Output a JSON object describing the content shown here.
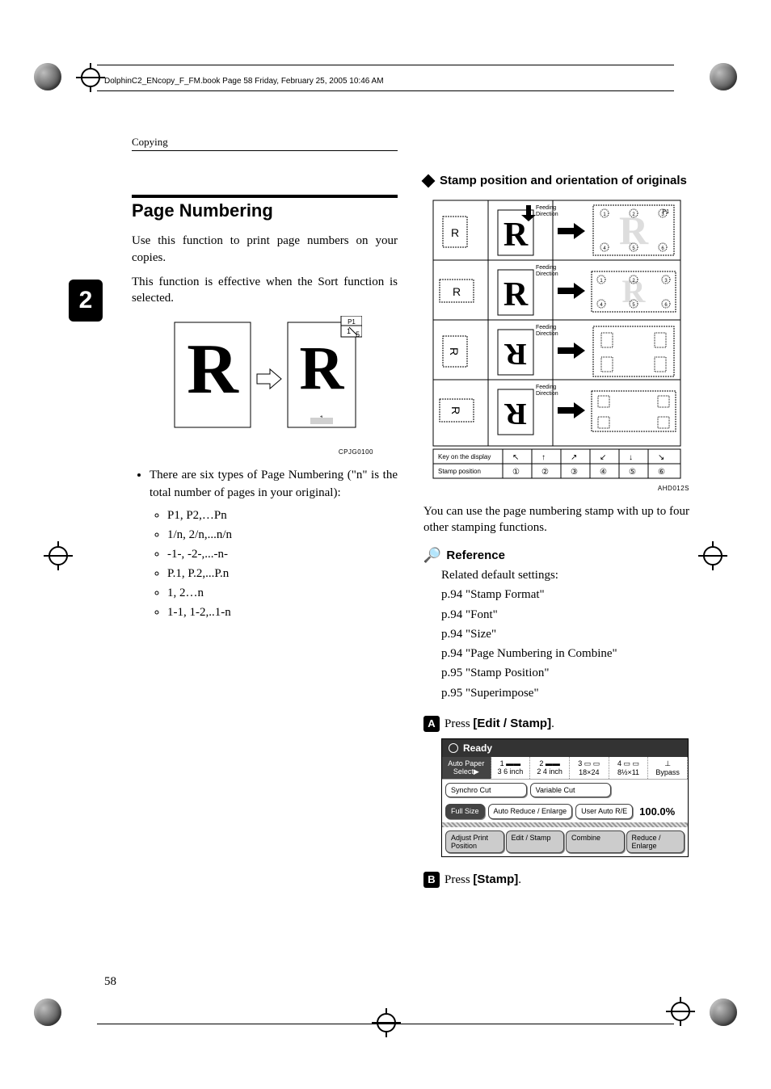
{
  "header_line": "DolphinC2_ENcopy_F_FM.book  Page 58  Friday, February 25, 2005  10:46 AM",
  "chapter_label": "Copying",
  "section_tab": "2",
  "page_number": "58",
  "left": {
    "title": "Page Numbering",
    "p1": "Use this function to print page numbers on your copies.",
    "p2": "This function is effective when the Sort function is selected.",
    "fig_id": "CPJG0100",
    "bullet_intro": "There are six types of Page Numbering (\"n\" is the total number of pages in your original):",
    "types": [
      "P1, P2,…Pn",
      "1/n, 2/n,...n/n",
      "-1-, -2-,...-n-",
      "P.1, P.2,...P.n",
      "1, 2…n",
      "1-1, 1-2,..1-n"
    ]
  },
  "right": {
    "diamond_title": "Stamp position and orientation of originals",
    "fig_id": "AHD012S",
    "p1": "You can use the page numbering stamp with up to four other stamping functions.",
    "ref_title": "Reference",
    "ref_intro": "Related default settings:",
    "refs": [
      "p.94 \"Stamp Format\"",
      "p.94 \"Font\"",
      "p.94 \"Size\"",
      "p.94 \"Page Numbering in Combine\"",
      "p.95 \"Stamp Position\"",
      "p.95 \"Superimpose\""
    ],
    "step1_pre": "Press ",
    "step1_b": "[Edit / Stamp]",
    "step1_post": ".",
    "step2_pre": "Press ",
    "step2_b": "[Stamp]",
    "step2_post": "."
  },
  "screenshot": {
    "ready": "Ready",
    "auto_paper": "Auto Paper Select▶",
    "paper1": "3 6 inch",
    "paper2": "2 4 inch",
    "paper3": "18×24",
    "paper4": "8½×11",
    "bypass": "Bypass",
    "synchro": "Synchro Cut",
    "variable": "Variable Cut",
    "fullsize": "Full Size",
    "autored": "Auto Reduce / Enlarge",
    "userauto": "User Auto R/E",
    "ratio": "100.0%",
    "adjust": "Adjust Print Position",
    "editstamp": "Edit / Stamp",
    "combine": "Combine",
    "reduce": "Reduce / Enlarge"
  }
}
